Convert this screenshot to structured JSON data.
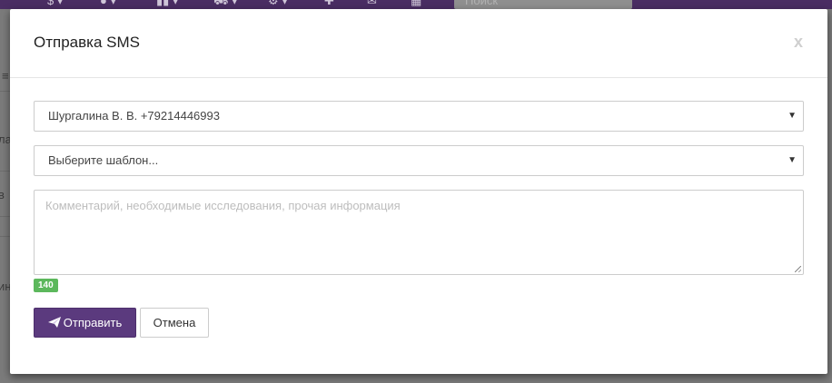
{
  "background": {
    "navbar_items": [
      "$ ▾",
      "● ▾",
      "▮▮ ▾",
      "⛟ ▾",
      "⚙ ▾",
      "✚",
      "✉",
      "▦"
    ],
    "search_placeholder": "Поиск",
    "left_fragments": [
      "≡",
      "ла",
      "в",
      "ин"
    ]
  },
  "modal": {
    "title": "Отправка SMS",
    "close_label": "x",
    "recipient_select": {
      "value": "Шургалина В. В. +79214446993",
      "caret": "▼"
    },
    "template_select": {
      "value": "Выберите шаблон...",
      "caret": "▼"
    },
    "comment": {
      "placeholder": "Комментарий, необходимые исследования, прочая информация",
      "value": ""
    },
    "char_counter": "140",
    "send_button": "Отправить",
    "cancel_button": "Отмена"
  },
  "colors": {
    "primary": "#5b3a7e",
    "navbar": "#4a2d63",
    "success_badge": "#5cb85c"
  }
}
